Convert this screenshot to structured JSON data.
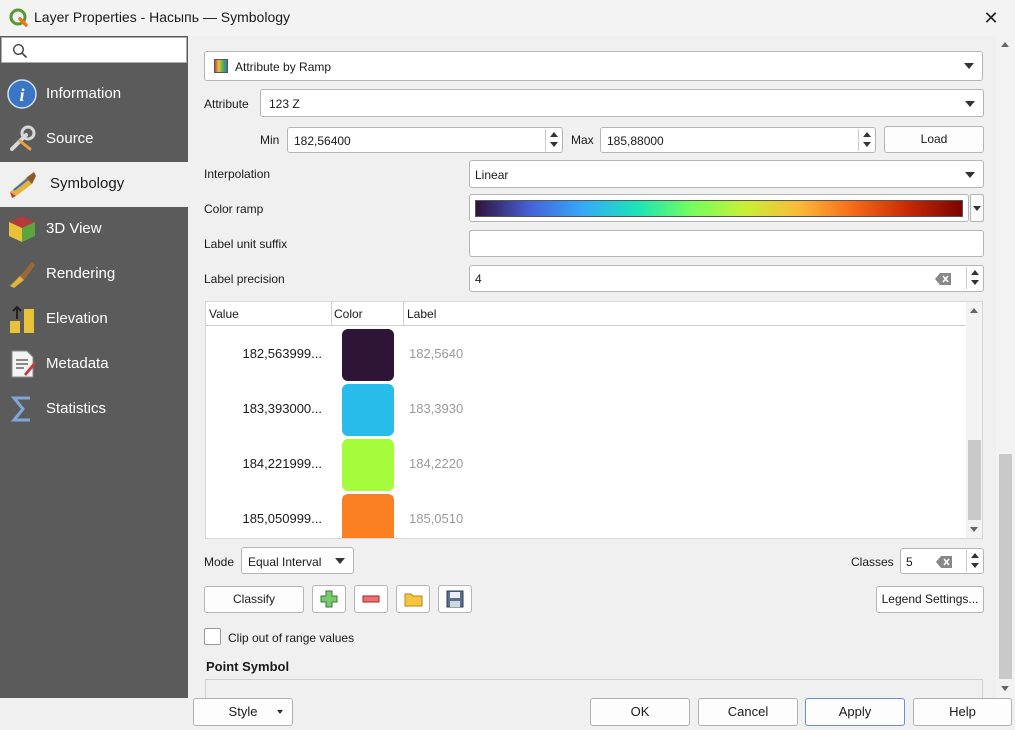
{
  "window": {
    "title": "Layer Properties - Насыпь — Symbology",
    "close_glyph": "✕"
  },
  "sidebar": {
    "search_placeholder": "",
    "items": [
      {
        "label": "Information",
        "icon": "info-icon"
      },
      {
        "label": "Source",
        "icon": "source-icon"
      },
      {
        "label": "Symbology",
        "icon": "symbology-icon",
        "active": true
      },
      {
        "label": "3D View",
        "icon": "3d-view-icon"
      },
      {
        "label": "Rendering",
        "icon": "rendering-icon"
      },
      {
        "label": "Elevation",
        "icon": "elevation-icon"
      },
      {
        "label": "Metadata",
        "icon": "metadata-icon"
      },
      {
        "label": "Statistics",
        "icon": "statistics-icon"
      }
    ]
  },
  "symbology": {
    "renderer": "Attribute by Ramp",
    "attribute_label": "Attribute",
    "attribute_value": "123 Z",
    "min_label": "Min",
    "min_value": "182,56400",
    "max_label": "Max",
    "max_value": "185,88000",
    "load_button": "Load",
    "interpolation_label": "Interpolation",
    "interpolation_value": "Linear",
    "color_ramp_label": "Color ramp",
    "label_unit_suffix_label": "Label unit suffix",
    "label_unit_suffix_value": "",
    "label_precision_label": "Label precision",
    "label_precision_value": "4",
    "table": {
      "headers": [
        "Value",
        "Color",
        "Label"
      ],
      "rows": [
        {
          "value": "182,563999...",
          "color": "#2e1538",
          "label": "182,5640"
        },
        {
          "value": "183,393000...",
          "color": "#28bceb",
          "label": "183,3930"
        },
        {
          "value": "184,221999...",
          "color": "#a4fc3c",
          "label": "184,2220"
        },
        {
          "value": "185,050999...",
          "color": "#fb8022",
          "label": "185,0510"
        }
      ]
    },
    "mode_label": "Mode",
    "mode_value": "Equal Interval",
    "classes_label": "Classes",
    "classes_value": "5",
    "classify_button": "Classify",
    "legend_settings_button": "Legend Settings...",
    "clip_label": "Clip out of range values",
    "point_symbol_heading": "Point Symbol"
  },
  "footer": {
    "style_button": "Style",
    "ok_button": "OK",
    "cancel_button": "Cancel",
    "apply_button": "Apply",
    "help_button": "Help"
  },
  "colors": {
    "sidebar_bg": "#5b5b5b",
    "accent": "#6a8fd0",
    "ramp": [
      "#30123b",
      "#4662d7",
      "#35abf8",
      "#1be5b5",
      "#74fe5d",
      "#c9ef34",
      "#fbb938",
      "#f56918",
      "#c92903",
      "#7a0403"
    ]
  }
}
